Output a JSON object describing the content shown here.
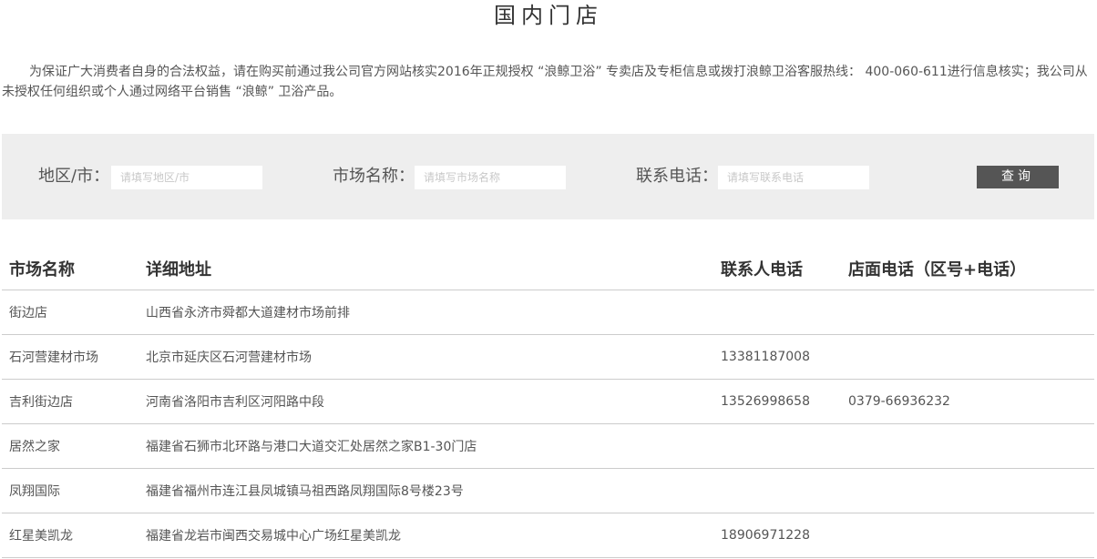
{
  "page": {
    "title": "国内门店",
    "notice": "为保证广大消费者自身的合法权益，请在购买前通过我公司官方网站核实2016年正规授权 “浪鲸卫浴” 专卖店及专柜信息或拨打浪鲸卫浴客服热线： 400-060-611进行信息核实；我公司从未授权任何组织或个人通过网络平台销售 “浪鲸” 卫浴产品。"
  },
  "search": {
    "region_label": "地区/市：",
    "region_placeholder": "请填写地区/市",
    "market_label": "市场名称：",
    "market_placeholder": "请填写市场名称",
    "phone_label": "联系电话：",
    "phone_placeholder": "请填写联系电话",
    "button_label": "查询"
  },
  "table": {
    "headers": [
      "市场名称",
      "详细地址",
      "联系人电话",
      "店面电话（区号+电话）"
    ],
    "rows": [
      [
        "街边店",
        "山西省永济市舜都大道建材市场前排",
        "",
        ""
      ],
      [
        "石河营建材市场",
        "北京市延庆区石河营建材市场",
        "13381187008",
        ""
      ],
      [
        "吉利街边店",
        "河南省洛阳市吉利区河阳路中段",
        "13526998658",
        "0379-66936232"
      ],
      [
        "居然之家",
        "福建省石狮市北环路与港口大道交汇处居然之家B1-30门店",
        "",
        ""
      ],
      [
        "凤翔国际",
        "福建省福州市连江县凤城镇马祖西路凤翔国际8号楼23号",
        "",
        ""
      ],
      [
        "红星美凯龙",
        "福建省龙岩市闽西交易城中心广场红星美凯龙",
        "18906971228",
        ""
      ]
    ]
  },
  "colors": {
    "panel_background": "#eeeeee",
    "button_background": "#555555",
    "divider": "#cccccc"
  }
}
